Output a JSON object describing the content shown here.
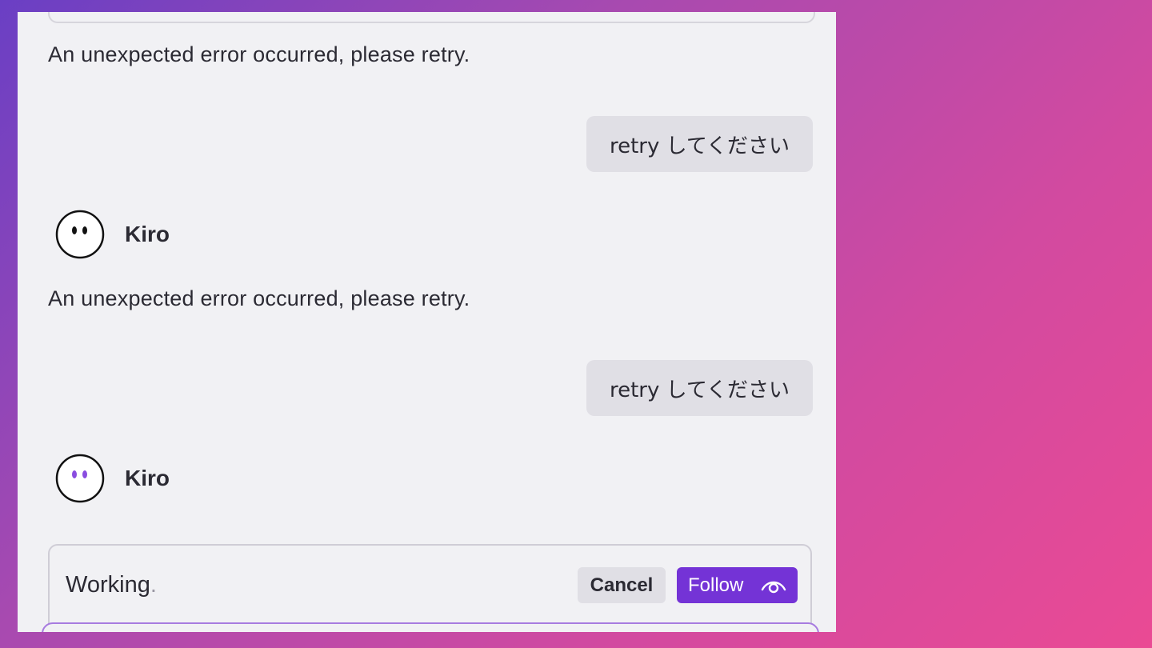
{
  "messages": [
    {
      "role": "agent",
      "text": "An unexpected error occurred, please retry."
    },
    {
      "role": "user",
      "text": "retry してください"
    },
    {
      "role": "agent",
      "name": "Kiro",
      "text": "An unexpected error occurred, please retry."
    },
    {
      "role": "user",
      "text": "retry してください"
    },
    {
      "role": "agent",
      "name": "Kiro",
      "text": ""
    }
  ],
  "status": {
    "text": "Working",
    "dots": ".",
    "cancel_label": "Cancel",
    "follow_label": "Follow"
  },
  "icons": {
    "avatar": "kiro-ghost-icon",
    "follow": "eye-icon"
  },
  "colors": {
    "accent": "#7433d6",
    "panel_bg": "#f1f1f4",
    "bubble_bg": "#e0dfe5",
    "avatar_eyes_active": "#8a4de0"
  }
}
